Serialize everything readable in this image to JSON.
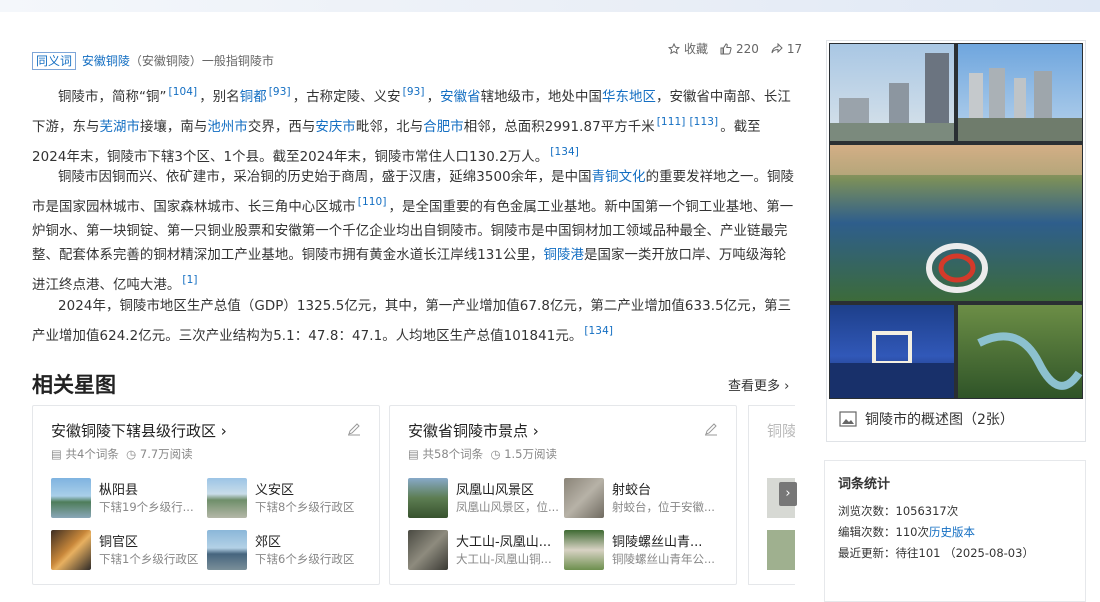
{
  "synonym": {
    "badge": "同义词",
    "term": "安徽铜陵",
    "paren": "（安徽铜陵）",
    "rest": "一般指铜陵市"
  },
  "actions": {
    "collect": "收藏",
    "like_count": "220",
    "share_count": "17"
  },
  "para1": {
    "t1": "铜陵市，简称“铜”",
    "r1": "[104]",
    "t2": "，别名",
    "l1": "铜都",
    "r2": "[93]",
    "t3": "，古称定陵、义安",
    "r3": "[93]",
    "t4": "，",
    "l2": "安徽省",
    "t5": "辖地级市，地处中国",
    "l3": "华东地区",
    "t6": "，安徽省中南部、长江下游，东与",
    "l4": "芜湖市",
    "t7": "接壤，南与",
    "l5": "池州市",
    "t8": "交界，西与",
    "l6": "安庆市",
    "t9": "毗邻，北与",
    "l7": "合肥市",
    "t10": "相邻，总面积2991.87平方千米",
    "r4": "[111]",
    "r5": "[113]",
    "t11": "。截至2024年末，铜陵市下辖3个区、1个县。截至2024年末，铜陵市常住人口130.2万人。",
    "r6": "[134]"
  },
  "para2": {
    "t1": "铜陵市因铜而兴、依矿建市，采冶铜的历史始于商周，盛于汉唐，延绵3500余年，是中国",
    "l1": "青铜文化",
    "t2": "的重要发祥地之一。铜陵市是国家园林城市、国家森林城市、长三角中心区城市",
    "r1": "[110]",
    "t3": "，是全国重要的有色金属工业基地。新中国第一个铜工业基地、第一炉铜水、第一块铜锭、第一只铜业股票和安徽第一个千亿企业均出自铜陵市。铜陵市是中国铜材加工领域品种最全、产业链最完整、配套体系完善的铜材精深加工产业基地。铜陵市拥有黄金水道长江岸线131公里，",
    "l2": "铜陵港",
    "t4": "是国家一类开放口岸、万吨级海轮进江终点港、亿吨大港。",
    "r2": "[1]"
  },
  "para3": {
    "t1": "2024年，铜陵市地区生产总值（GDP）1325.5亿元，其中，第一产业增加值67.8亿元，第二产业增加值633.5亿元，第三产业增加值624.2亿元。三次产业结构为5.1：47.8：47.1。人均地区生产总值101841元。",
    "r1": "[134]"
  },
  "related": {
    "title": "相关星图",
    "more": "查看更多",
    "cards": [
      {
        "title": "安徽铜陵下辖县级行政区",
        "entries": "共4个词条",
        "reads": "7.7万阅读",
        "items": [
          {
            "name": "枞阳县",
            "desc": "下辖19个乡级行..."
          },
          {
            "name": "义安区",
            "desc": "下辖8个乡级行政区"
          },
          {
            "name": "铜官区",
            "desc": "下辖1个乡级行政区"
          },
          {
            "name": "郊区",
            "desc": "下辖6个乡级行政区"
          }
        ]
      },
      {
        "title": "安徽省铜陵市景点",
        "entries": "共58个词条",
        "reads": "1.5万阅读",
        "items": [
          {
            "name": "凤凰山风景区",
            "desc": "凤凰山风景区，位..."
          },
          {
            "name": "射蛟台",
            "desc": "射蛟台，位于安徽..."
          },
          {
            "name": "大工山-凤凰山...",
            "desc": "大工山-凤凰山铜..."
          },
          {
            "name": "铜陵螺丝山青...",
            "desc": "铜陵螺丝山青年公..."
          }
        ]
      }
    ],
    "card3_title": "铜陵"
  },
  "gallery": {
    "caption": "铜陵市的概述图（2张）"
  },
  "stats": {
    "title": "词条统计",
    "views_label": "浏览次数：",
    "views": "1056317次",
    "edits_label": "编辑次数：",
    "edits": "110次",
    "history": "历史版本",
    "updated_label": "最近更新：",
    "updated": "待往101 （2025-08-03）"
  }
}
